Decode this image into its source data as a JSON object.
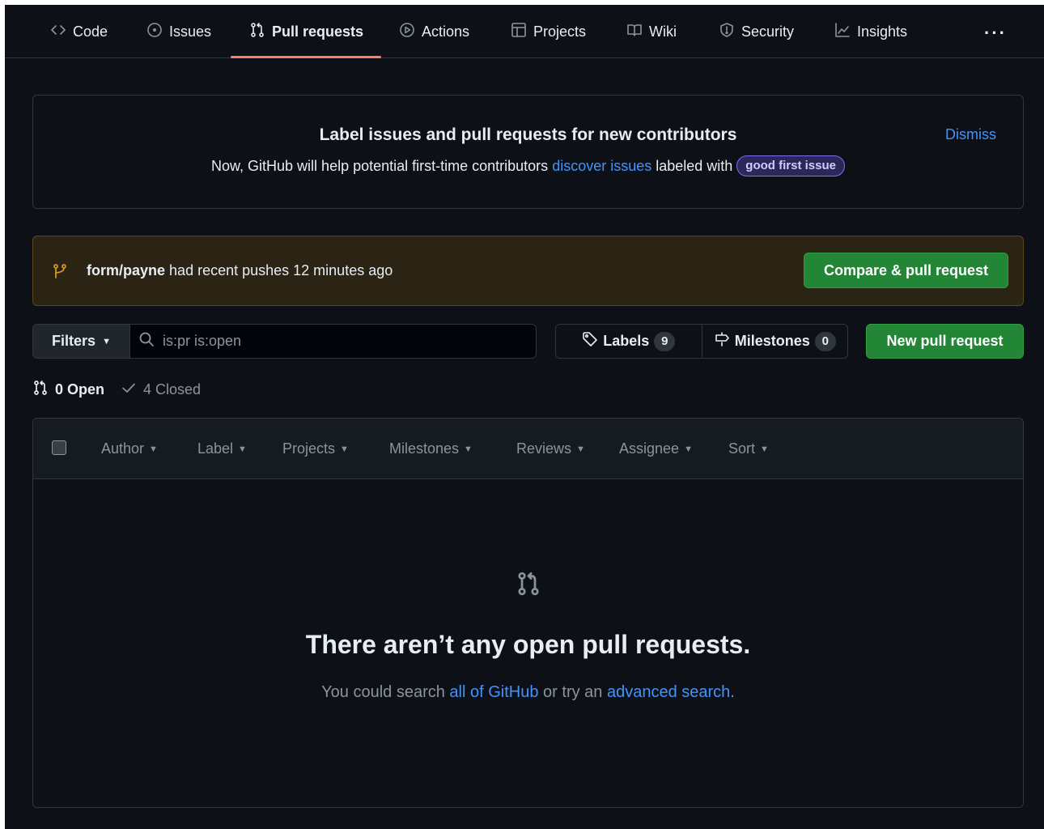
{
  "tabs": [
    {
      "label": "Code",
      "icon": "code-icon",
      "selected": false
    },
    {
      "label": "Issues",
      "icon": "issue-opened-icon",
      "selected": false
    },
    {
      "label": "Pull requests",
      "icon": "git-pull-request-icon",
      "selected": true
    },
    {
      "label": "Actions",
      "icon": "play-icon",
      "selected": false
    },
    {
      "label": "Projects",
      "icon": "table-icon",
      "selected": false
    },
    {
      "label": "Wiki",
      "icon": "book-icon",
      "selected": false
    },
    {
      "label": "Security",
      "icon": "shield-icon",
      "selected": false
    },
    {
      "label": "Insights",
      "icon": "graph-icon",
      "selected": false
    }
  ],
  "more_label": "···",
  "banner": {
    "title": "Label issues and pull requests for new contributors",
    "text_before": "Now, GitHub will help potential first-time contributors",
    "link": "discover issues",
    "text_after": "labeled with",
    "label": "good first issue",
    "dismiss": "Dismiss"
  },
  "pushes": {
    "branch": "form/payne",
    "text": "had recent pushes 12 minutes ago",
    "button": "Compare & pull request"
  },
  "filter_bar": {
    "filters_label": "Filters",
    "search_value": "is:pr is:open",
    "labels_label": "Labels",
    "labels_count": "9",
    "milestones_label": "Milestones",
    "milestones_count": "0",
    "new_pr_label": "New pull request"
  },
  "states": {
    "open_label": "0 Open",
    "closed_label": "4 Closed"
  },
  "list_header": {
    "filters": [
      "Author",
      "Label",
      "Projects",
      "Milestones",
      "Reviews",
      "Assignee",
      "Sort"
    ]
  },
  "blankslate": {
    "title": "There aren’t any open pull requests.",
    "text_1": "You could search",
    "link_1": "all of GitHub",
    "text_2": "or try an",
    "link_2": "advanced search",
    "text_3": "."
  },
  "colors": {
    "background": "#0d1117",
    "accent_underline": "#f78166",
    "link": "#4493f8",
    "primary_button": "#238636",
    "push_banner_bg": "#2b2414"
  }
}
